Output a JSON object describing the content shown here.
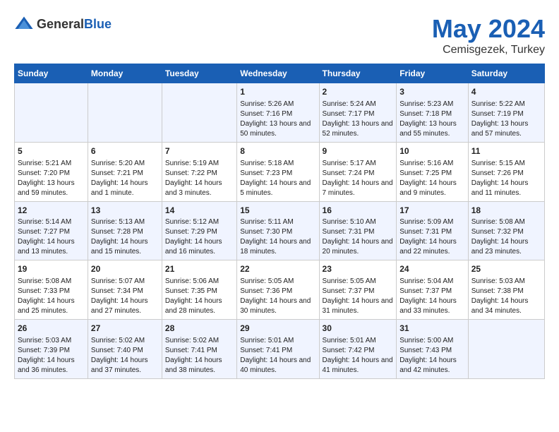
{
  "logo": {
    "general": "General",
    "blue": "Blue"
  },
  "title": "May 2024",
  "subtitle": "Cemisgezek, Turkey",
  "days_header": [
    "Sunday",
    "Monday",
    "Tuesday",
    "Wednesday",
    "Thursday",
    "Friday",
    "Saturday"
  ],
  "weeks": [
    [
      {
        "day": "",
        "sunrise": "",
        "sunset": "",
        "daylight": ""
      },
      {
        "day": "",
        "sunrise": "",
        "sunset": "",
        "daylight": ""
      },
      {
        "day": "",
        "sunrise": "",
        "sunset": "",
        "daylight": ""
      },
      {
        "day": "1",
        "sunrise": "Sunrise: 5:26 AM",
        "sunset": "Sunset: 7:16 PM",
        "daylight": "Daylight: 13 hours and 50 minutes."
      },
      {
        "day": "2",
        "sunrise": "Sunrise: 5:24 AM",
        "sunset": "Sunset: 7:17 PM",
        "daylight": "Daylight: 13 hours and 52 minutes."
      },
      {
        "day": "3",
        "sunrise": "Sunrise: 5:23 AM",
        "sunset": "Sunset: 7:18 PM",
        "daylight": "Daylight: 13 hours and 55 minutes."
      },
      {
        "day": "4",
        "sunrise": "Sunrise: 5:22 AM",
        "sunset": "Sunset: 7:19 PM",
        "daylight": "Daylight: 13 hours and 57 minutes."
      }
    ],
    [
      {
        "day": "5",
        "sunrise": "Sunrise: 5:21 AM",
        "sunset": "Sunset: 7:20 PM",
        "daylight": "Daylight: 13 hours and 59 minutes."
      },
      {
        "day": "6",
        "sunrise": "Sunrise: 5:20 AM",
        "sunset": "Sunset: 7:21 PM",
        "daylight": "Daylight: 14 hours and 1 minute."
      },
      {
        "day": "7",
        "sunrise": "Sunrise: 5:19 AM",
        "sunset": "Sunset: 7:22 PM",
        "daylight": "Daylight: 14 hours and 3 minutes."
      },
      {
        "day": "8",
        "sunrise": "Sunrise: 5:18 AM",
        "sunset": "Sunset: 7:23 PM",
        "daylight": "Daylight: 14 hours and 5 minutes."
      },
      {
        "day": "9",
        "sunrise": "Sunrise: 5:17 AM",
        "sunset": "Sunset: 7:24 PM",
        "daylight": "Daylight: 14 hours and 7 minutes."
      },
      {
        "day": "10",
        "sunrise": "Sunrise: 5:16 AM",
        "sunset": "Sunset: 7:25 PM",
        "daylight": "Daylight: 14 hours and 9 minutes."
      },
      {
        "day": "11",
        "sunrise": "Sunrise: 5:15 AM",
        "sunset": "Sunset: 7:26 PM",
        "daylight": "Daylight: 14 hours and 11 minutes."
      }
    ],
    [
      {
        "day": "12",
        "sunrise": "Sunrise: 5:14 AM",
        "sunset": "Sunset: 7:27 PM",
        "daylight": "Daylight: 14 hours and 13 minutes."
      },
      {
        "day": "13",
        "sunrise": "Sunrise: 5:13 AM",
        "sunset": "Sunset: 7:28 PM",
        "daylight": "Daylight: 14 hours and 15 minutes."
      },
      {
        "day": "14",
        "sunrise": "Sunrise: 5:12 AM",
        "sunset": "Sunset: 7:29 PM",
        "daylight": "Daylight: 14 hours and 16 minutes."
      },
      {
        "day": "15",
        "sunrise": "Sunrise: 5:11 AM",
        "sunset": "Sunset: 7:30 PM",
        "daylight": "Daylight: 14 hours and 18 minutes."
      },
      {
        "day": "16",
        "sunrise": "Sunrise: 5:10 AM",
        "sunset": "Sunset: 7:31 PM",
        "daylight": "Daylight: 14 hours and 20 minutes."
      },
      {
        "day": "17",
        "sunrise": "Sunrise: 5:09 AM",
        "sunset": "Sunset: 7:31 PM",
        "daylight": "Daylight: 14 hours and 22 minutes."
      },
      {
        "day": "18",
        "sunrise": "Sunrise: 5:08 AM",
        "sunset": "Sunset: 7:32 PM",
        "daylight": "Daylight: 14 hours and 23 minutes."
      }
    ],
    [
      {
        "day": "19",
        "sunrise": "Sunrise: 5:08 AM",
        "sunset": "Sunset: 7:33 PM",
        "daylight": "Daylight: 14 hours and 25 minutes."
      },
      {
        "day": "20",
        "sunrise": "Sunrise: 5:07 AM",
        "sunset": "Sunset: 7:34 PM",
        "daylight": "Daylight: 14 hours and 27 minutes."
      },
      {
        "day": "21",
        "sunrise": "Sunrise: 5:06 AM",
        "sunset": "Sunset: 7:35 PM",
        "daylight": "Daylight: 14 hours and 28 minutes."
      },
      {
        "day": "22",
        "sunrise": "Sunrise: 5:05 AM",
        "sunset": "Sunset: 7:36 PM",
        "daylight": "Daylight: 14 hours and 30 minutes."
      },
      {
        "day": "23",
        "sunrise": "Sunrise: 5:05 AM",
        "sunset": "Sunset: 7:37 PM",
        "daylight": "Daylight: 14 hours and 31 minutes."
      },
      {
        "day": "24",
        "sunrise": "Sunrise: 5:04 AM",
        "sunset": "Sunset: 7:37 PM",
        "daylight": "Daylight: 14 hours and 33 minutes."
      },
      {
        "day": "25",
        "sunrise": "Sunrise: 5:03 AM",
        "sunset": "Sunset: 7:38 PM",
        "daylight": "Daylight: 14 hours and 34 minutes."
      }
    ],
    [
      {
        "day": "26",
        "sunrise": "Sunrise: 5:03 AM",
        "sunset": "Sunset: 7:39 PM",
        "daylight": "Daylight: 14 hours and 36 minutes."
      },
      {
        "day": "27",
        "sunrise": "Sunrise: 5:02 AM",
        "sunset": "Sunset: 7:40 PM",
        "daylight": "Daylight: 14 hours and 37 minutes."
      },
      {
        "day": "28",
        "sunrise": "Sunrise: 5:02 AM",
        "sunset": "Sunset: 7:41 PM",
        "daylight": "Daylight: 14 hours and 38 minutes."
      },
      {
        "day": "29",
        "sunrise": "Sunrise: 5:01 AM",
        "sunset": "Sunset: 7:41 PM",
        "daylight": "Daylight: 14 hours and 40 minutes."
      },
      {
        "day": "30",
        "sunrise": "Sunrise: 5:01 AM",
        "sunset": "Sunset: 7:42 PM",
        "daylight": "Daylight: 14 hours and 41 minutes."
      },
      {
        "day": "31",
        "sunrise": "Sunrise: 5:00 AM",
        "sunset": "Sunset: 7:43 PM",
        "daylight": "Daylight: 14 hours and 42 minutes."
      },
      {
        "day": "",
        "sunrise": "",
        "sunset": "",
        "daylight": ""
      }
    ]
  ]
}
